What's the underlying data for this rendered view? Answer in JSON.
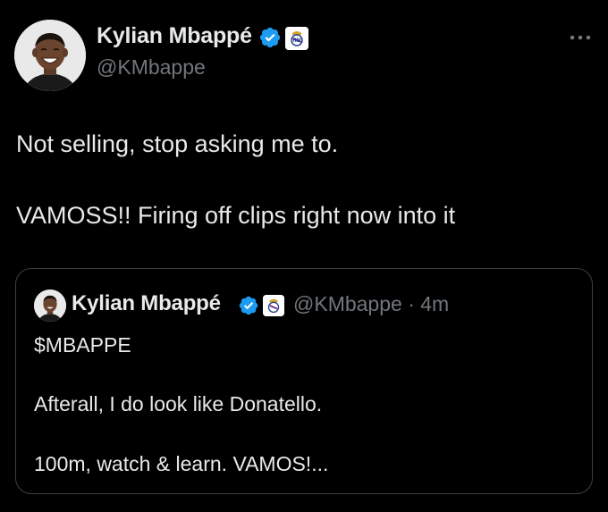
{
  "author": {
    "display_name": "Kylian Mbappé",
    "handle": "@KMbappe"
  },
  "tweet": {
    "line1": "Not selling, stop asking me to.",
    "line2": "VAMOSS!! Firing off clips right now into it"
  },
  "quoted_tweet": {
    "display_name": "Kylian Mbappé",
    "handle_time": "@KMbappe · 4m",
    "line1": "$MBAPPE",
    "line2": "Afterall, I do look like Donatello.",
    "line3": "100m, watch & learn. VAMOS!..."
  },
  "icons": {
    "verified": "verified-badge-icon",
    "affiliate": "real-madrid-crest-icon",
    "more": "more-options-icon"
  },
  "colors": {
    "background": "#000000",
    "text": "#e7e9ea",
    "secondary_text": "#71767b",
    "verified_blue": "#1d9bf0",
    "border": "#3a3e43"
  }
}
